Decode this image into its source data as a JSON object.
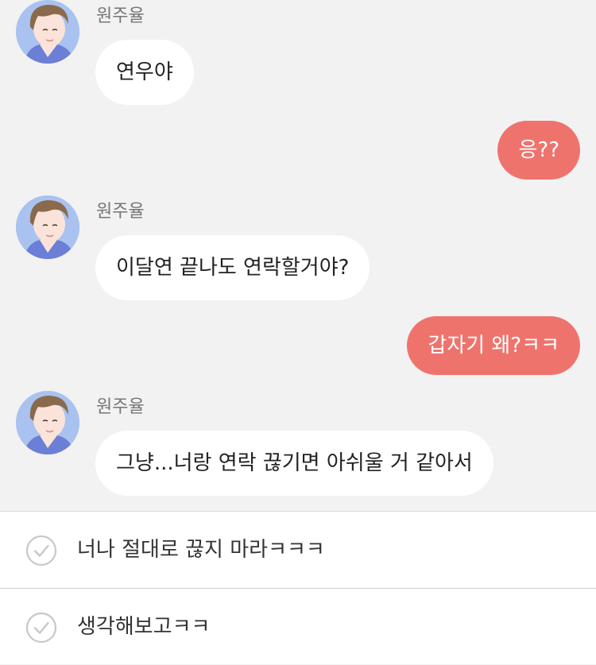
{
  "chat": {
    "messages": [
      {
        "from": "in",
        "sender": "원주율",
        "text": "연우야"
      },
      {
        "from": "out",
        "text": "응??"
      },
      {
        "from": "in",
        "sender": "원주율",
        "text": "이달연 끝나도 연락할거야?"
      },
      {
        "from": "out",
        "text": "갑자기 왜?ㅋㅋ"
      },
      {
        "from": "in",
        "sender": "원주율",
        "text": "그냥...너랑 연락 끊기면 아쉬울 거 같아서"
      }
    ]
  },
  "choices": [
    {
      "label": "너나 절대로 끊지 마라ㅋㅋㅋ"
    },
    {
      "label": "생각해보고ㅋㅋ"
    }
  ],
  "colors": {
    "background": "#f2f2f2",
    "incoming_bubble": "#ffffff",
    "outgoing_bubble": "#ef736d",
    "sender_name": "#767676"
  },
  "icons": {
    "avatar": "boy-portrait-avatar",
    "choice": "check-circle-icon"
  }
}
